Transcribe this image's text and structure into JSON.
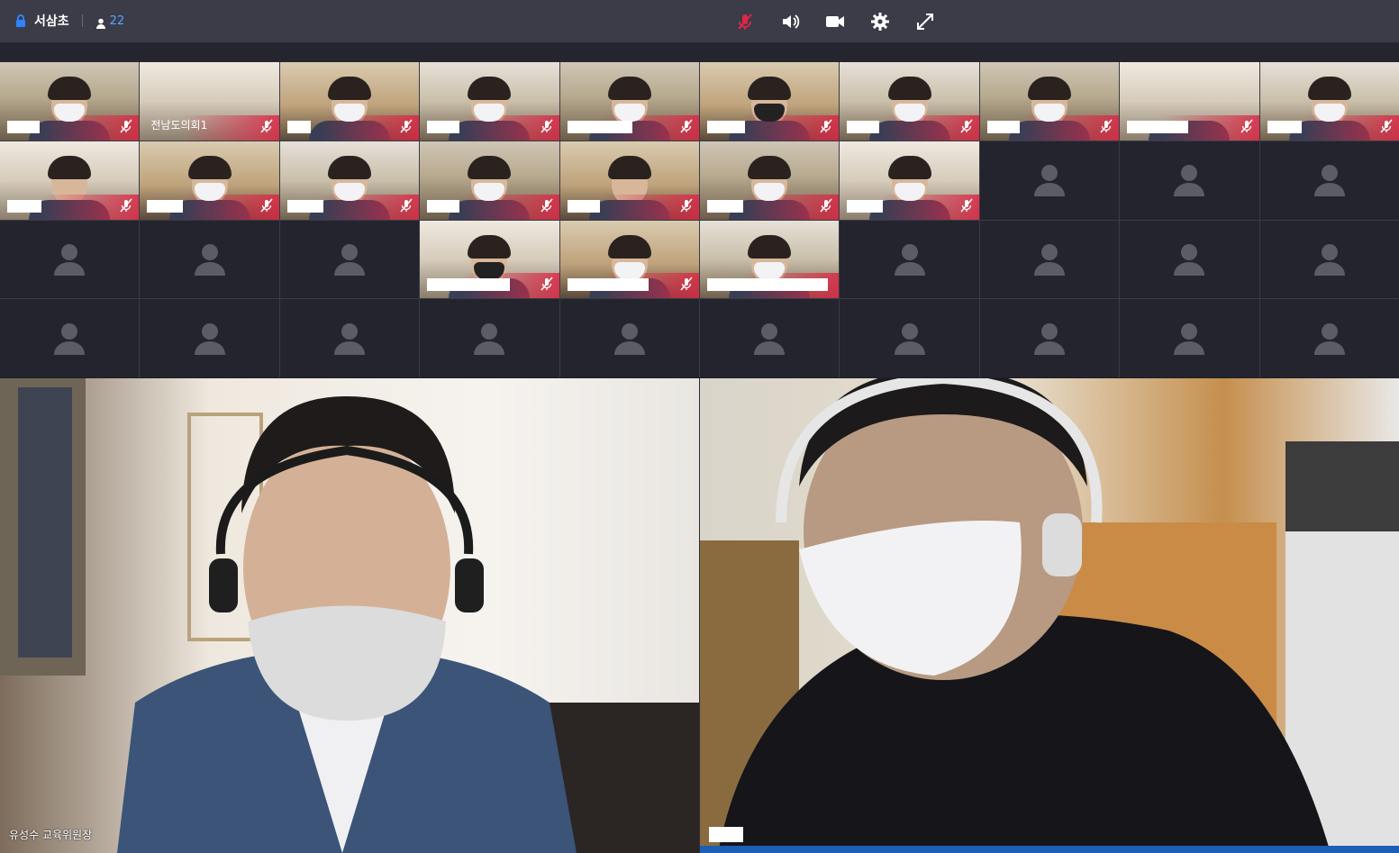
{
  "room": {
    "name": "서삼초",
    "participants": "22"
  },
  "controls": [
    {
      "name": "mic-muted-icon"
    },
    {
      "name": "speaker-icon"
    },
    {
      "name": "camera-icon"
    },
    {
      "name": "settings-gear-icon"
    },
    {
      "name": "fullscreen-icon"
    }
  ],
  "grid_labels": {
    "council": "전남도의회1"
  },
  "main_videos": {
    "left_name": "유성수 교육위원장"
  },
  "colors": {
    "topbar": "#3b3c47",
    "accent_blue": "#58a6ff",
    "muted_red": "#e0264a"
  }
}
